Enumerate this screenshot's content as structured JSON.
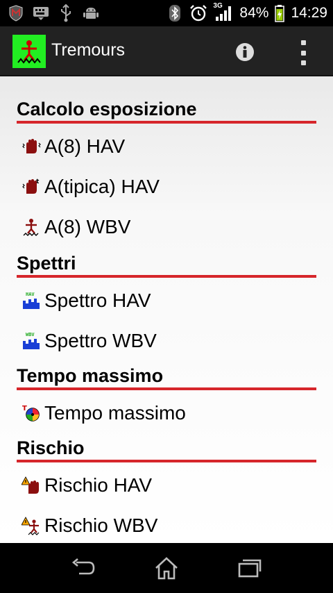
{
  "status_bar": {
    "battery_percent": "84%",
    "time": "14:29",
    "network_type": "3G",
    "icons": [
      "mcafee-icon",
      "keyboard-icon",
      "usb-icon",
      "android-debug-icon",
      "bluetooth-icon",
      "alarm-icon",
      "signal-icon",
      "battery-charging-icon"
    ]
  },
  "app_bar": {
    "title": "Tremours",
    "app_icon": "tremours-app-icon",
    "actions": [
      "info-icon",
      "overflow-menu-icon"
    ]
  },
  "sections": [
    {
      "title": "Calcolo esposizione",
      "items": [
        {
          "label": "A(8) HAV",
          "icon": "hand-vibration-icon"
        },
        {
          "label": "A(tipica) HAV",
          "icon": "hand-vibration-typical-icon"
        },
        {
          "label": "A(8) WBV",
          "icon": "whole-body-vibration-icon"
        }
      ]
    },
    {
      "title": "Spettri",
      "items": [
        {
          "label": "Spettro HAV",
          "icon": "spectrum-hav-icon"
        },
        {
          "label": "Spettro WBV",
          "icon": "spectrum-wbv-icon"
        }
      ]
    },
    {
      "title": "Tempo massimo",
      "items": [
        {
          "label": "Tempo massimo",
          "icon": "max-time-icon"
        }
      ]
    },
    {
      "title": "Rischio",
      "items": [
        {
          "label": "Rischio HAV",
          "icon": "risk-hav-icon"
        },
        {
          "label": "Rischio WBV",
          "icon": "risk-wbv-icon"
        }
      ]
    }
  ],
  "colors": {
    "accent": "#d6262b",
    "app_icon_bg": "#22ee22",
    "action_bar": "#222222"
  },
  "nav_bar": [
    "back-icon",
    "home-icon",
    "recent-apps-icon"
  ]
}
